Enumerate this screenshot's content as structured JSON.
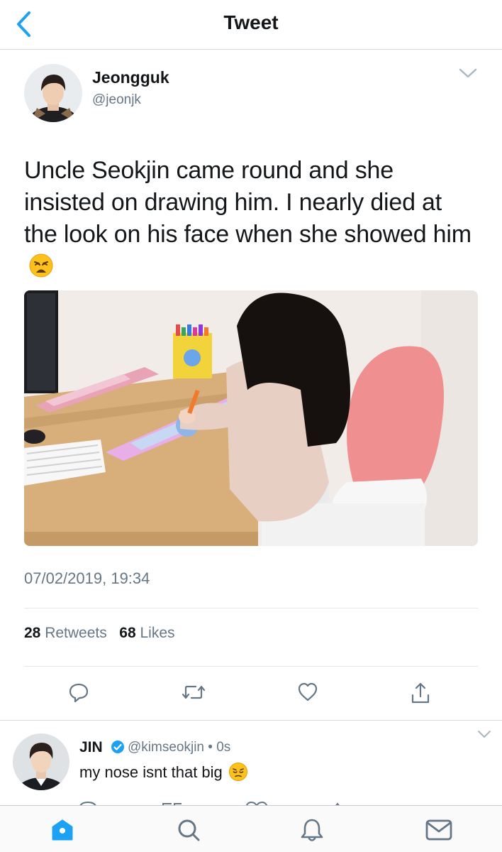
{
  "nav": {
    "title": "Tweet",
    "back_icon": "back-chevron-icon"
  },
  "tweet": {
    "author_name": "Jeongguk",
    "author_handle": "@jeonjk",
    "text": "Uncle Seokjin came round and she insisted on drawing him. I nearly died at the look on his face when she showed him",
    "emoji": "weary-face-emoji",
    "photo": "child-drawing-at-desk-photo",
    "timestamp": "07/02/2019, 19:34",
    "retweet_count": "28",
    "retweet_label": "Retweets",
    "like_count": "68",
    "like_label": "Likes",
    "actions": [
      "reply-icon",
      "retweet-icon",
      "like-icon",
      "share-icon"
    ]
  },
  "reply": {
    "author_name": "JIN",
    "verified": true,
    "author_handle": "@kimseokjin",
    "time": "0s",
    "meta_separator": "•",
    "text": "my nose isnt that big",
    "emoji": "pensive-face-emoji"
  },
  "tabbar": {
    "items": [
      "home-icon",
      "search-icon",
      "notifications-icon",
      "messages-icon"
    ],
    "active": "home-icon"
  },
  "colors": {
    "accent": "#1da1f2",
    "text": "#14171a",
    "secondary": "#657786",
    "divider": "#e1e8ed"
  }
}
